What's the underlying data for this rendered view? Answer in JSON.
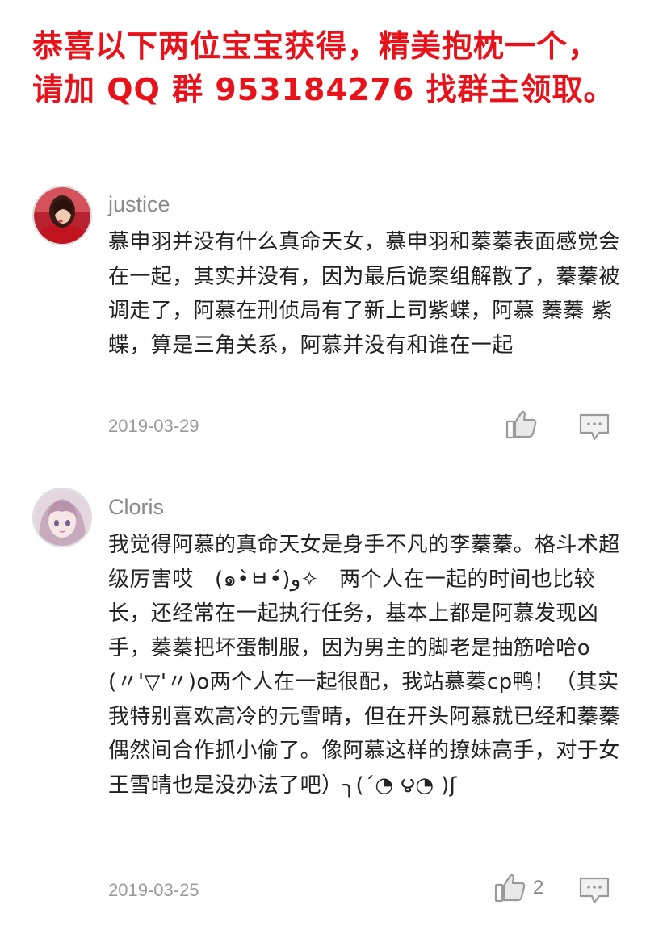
{
  "banner": {
    "line1": "恭喜以下两位宝宝获得，精美抱枕一个，",
    "line2": "请加 QQ 群  953184276 找群主领取。",
    "color": "#e8121b"
  },
  "comments": [
    {
      "username": "justice",
      "text": "慕申羽并没有什么真命天女，慕申羽和蓁蓁表面感觉会在一起，其实并没有，因为最后诡案组解散了，蓁蓁被调走了，阿慕在刑侦局有了新上司紫蝶，阿慕 蓁蓁 紫蝶，算是三角关系，阿慕并没有和谁在一起",
      "date": "2019-03-29",
      "likes": "",
      "avatar_icon": "avatar-red-dress-woman"
    },
    {
      "username": "Cloris",
      "text": "我觉得阿慕的真命天女是身手不凡的李蓁蓁。格斗术超级厉害哎　(๑•̀ㅂ•́)و✧　两个人在一起的时间也比较长，还经常在一起执行任务，基本上都是阿慕发现凶手，蓁蓁把坏蛋制服，因为男主的脚老是抽筋哈哈o(〃'▽'〃)o两个人在一起很配，我站慕蓁cp鸭！（其实我特别喜欢高冷的元雪晴，但在开头阿慕就已经和蓁蓁偶然间合作抓小偷了。像阿慕这样的撩妹高手，对于女王雪晴也是没办法了吧）╮(´◔ ౪◔ )ʃ",
      "date": "2019-03-25",
      "likes": "2",
      "avatar_icon": "avatar-anime-girl"
    }
  ]
}
